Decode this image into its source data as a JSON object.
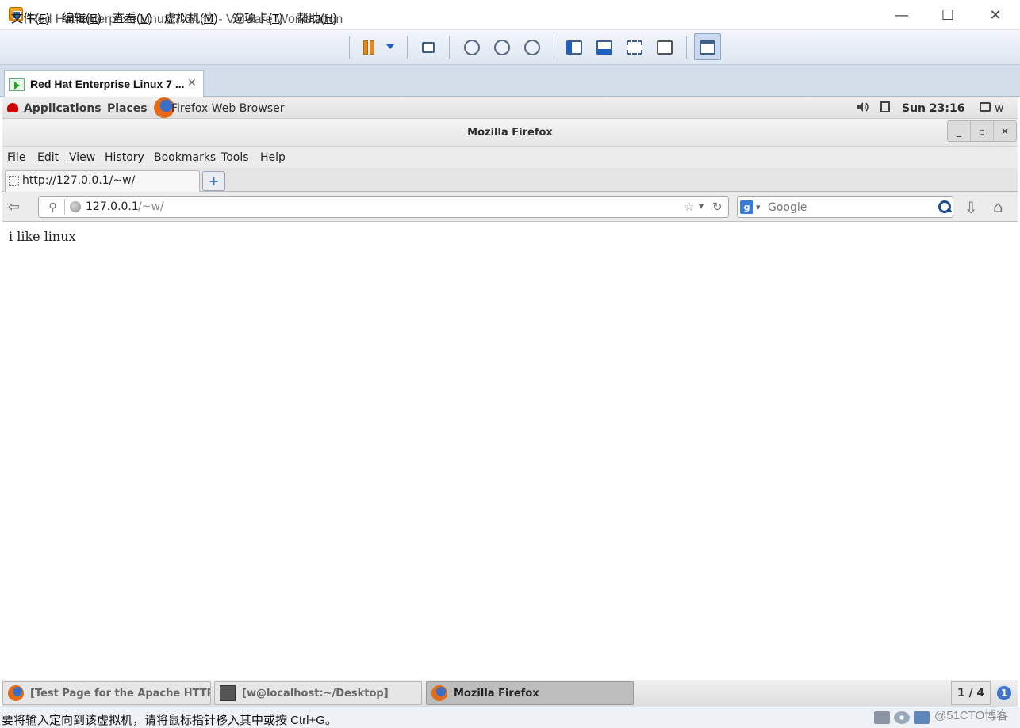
{
  "vmware": {
    "window_title": "Red Hat Enterprise Linux 7 64 位 - VMware Workstation",
    "window_controls": {
      "minimize": "—",
      "maximize": "☐",
      "close": "✕"
    },
    "menu": [
      {
        "pre": "文件(",
        "key": "F",
        "post": ")"
      },
      {
        "pre": "编辑(",
        "key": "E",
        "post": ")"
      },
      {
        "pre": "查看(",
        "key": "V",
        "post": ")"
      },
      {
        "pre": "虚拟机(",
        "key": "M",
        "post": ")"
      },
      {
        "pre": "选项卡(",
        "key": "T",
        "post": ")"
      },
      {
        "pre": "帮助(",
        "key": "H",
        "post": ")"
      }
    ],
    "toolbar_icons": [
      "pause-icon",
      "send-ctrl-alt-del-icon",
      "snapshot-take-icon",
      "snapshot-revert-icon",
      "snapshot-manager-icon",
      "show-library-icon",
      "thumbnail-bar-icon",
      "full-screen-icon",
      "unity-icon",
      "console-view-icon"
    ],
    "tab_label": "Red Hat Enterprise Linux 7 ...",
    "tab_close": "✕",
    "status_text": "要将输入定向到该虚拟机，请将鼠标指针移入其中或按 Ctrl+G。",
    "status_device_icons": [
      "hard-disk-icon",
      "cd-icon",
      "network-icon",
      "usb-icon",
      "sound-icon"
    ]
  },
  "gnome_panel": {
    "applications": "Applications",
    "places": "Places",
    "active_app": "Firefox Web Browser",
    "clock": "Sun 23:16",
    "user": "w"
  },
  "firefox": {
    "window_title": "Mozilla Firefox",
    "wm_buttons": {
      "minimize": "_",
      "maximize": "▫",
      "close": "✕"
    },
    "menu": [
      {
        "key": "F",
        "rest": "ile"
      },
      {
        "key": "E",
        "rest": "dit"
      },
      {
        "key": "V",
        "rest": "iew"
      },
      {
        "pre": "Hi",
        "key": "s",
        "rest": "tory"
      },
      {
        "key": "B",
        "rest": "ookmarks"
      },
      {
        "key": "T",
        "rest": "ools"
      },
      {
        "key": "H",
        "rest": "elp"
      }
    ],
    "tab_title": "http://127.0.0.1/~w/",
    "new_tab": "+",
    "url_host": "127.0.0.1",
    "url_path": "/~w/",
    "search_engine": "g",
    "search_placeholder": "Google",
    "page_content": "i like linux"
  },
  "taskbar": {
    "tasks": [
      {
        "label": "[Test Page for the Apache HTTP...",
        "icon": "firefox-icon",
        "active": false
      },
      {
        "label": "[w@localhost:~/Desktop]",
        "icon": "terminal-icon",
        "active": false
      },
      {
        "label": "Mozilla Firefox",
        "icon": "firefox-icon",
        "active": true
      }
    ],
    "workspace": "1 / 4",
    "notifications": "1"
  },
  "watermark": "@51CTO博客"
}
